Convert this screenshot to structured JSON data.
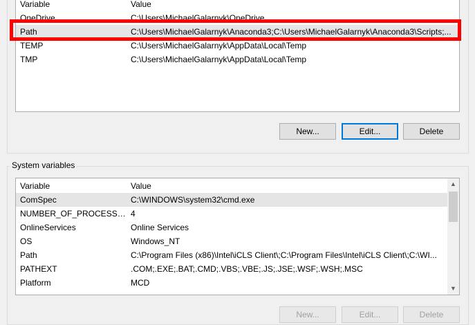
{
  "user_variables": {
    "header": {
      "variable": "Variable",
      "value": "Value"
    },
    "rows": [
      {
        "variable": "OneDrive",
        "value": "C:\\Users\\MichaelGalarnyk\\OneDrive"
      },
      {
        "variable": "Path",
        "value": "C:\\Users\\MichaelGalarnyk\\Anaconda3;C:\\Users\\MichaelGalarnyk\\Anaconda3\\Scripts;..."
      },
      {
        "variable": "TEMP",
        "value": "C:\\Users\\MichaelGalarnyk\\AppData\\Local\\Temp"
      },
      {
        "variable": "TMP",
        "value": "C:\\Users\\MichaelGalarnyk\\AppData\\Local\\Temp"
      }
    ],
    "buttons": {
      "new": "New...",
      "edit": "Edit...",
      "delete": "Delete"
    }
  },
  "system_variables": {
    "label": "System variables",
    "header": {
      "variable": "Variable",
      "value": "Value"
    },
    "rows": [
      {
        "variable": "ComSpec",
        "value": "C:\\WINDOWS\\system32\\cmd.exe"
      },
      {
        "variable": "NUMBER_OF_PROCESSORS",
        "value": "4"
      },
      {
        "variable": "OnlineServices",
        "value": "Online Services"
      },
      {
        "variable": "OS",
        "value": "Windows_NT"
      },
      {
        "variable": "Path",
        "value": "C:\\Program Files (x86)\\Intel\\iCLS Client\\;C:\\Program Files\\Intel\\iCLS Client\\;C:\\WI..."
      },
      {
        "variable": "PATHEXT",
        "value": ".COM;.EXE;.BAT;.CMD;.VBS;.VBE;.JS;.JSE;.WSF;.WSH;.MSC"
      },
      {
        "variable": "Platform",
        "value": "MCD"
      }
    ],
    "buttons": {
      "new": "New...",
      "edit": "Edit...",
      "delete": "Delete"
    }
  },
  "colors": {
    "selection_row": "#e5e5e5",
    "highlight_box": "#ff0000",
    "focus_border": "#0078d7"
  }
}
